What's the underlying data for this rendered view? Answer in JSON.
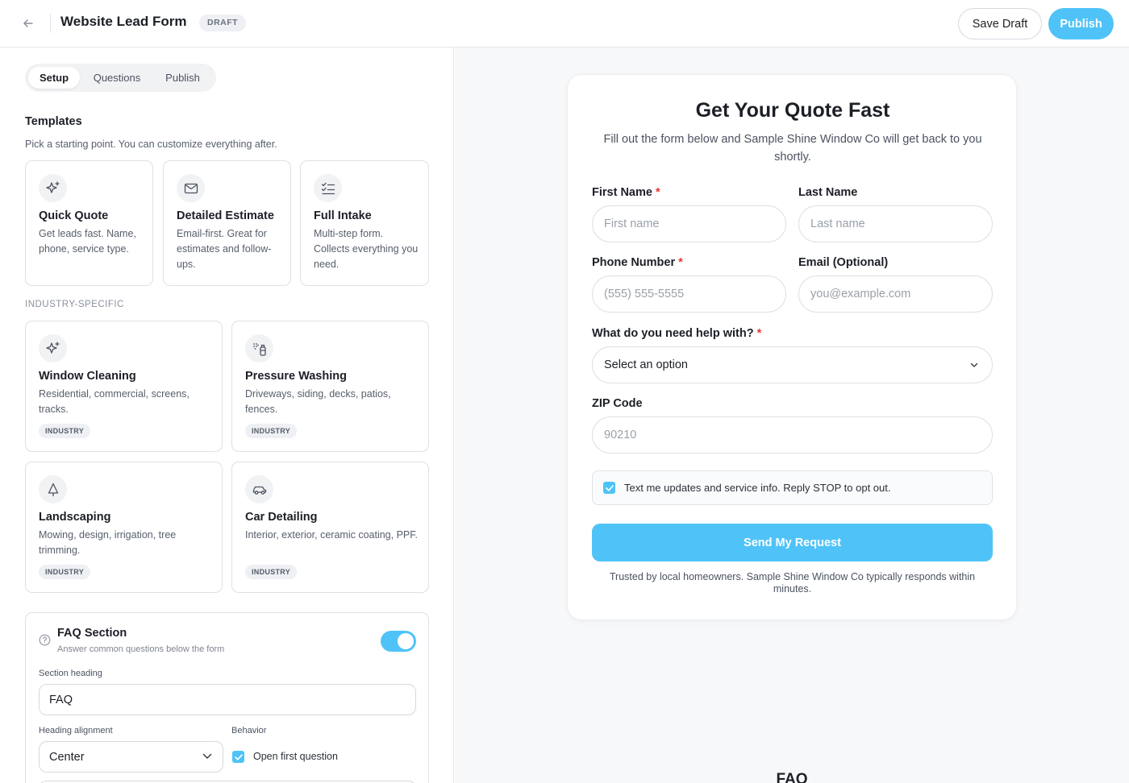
{
  "header": {
    "title": "Website Lead Form",
    "status": "DRAFT",
    "save_label": "Save Draft",
    "publish_label": "Publish"
  },
  "tabs": [
    {
      "label": "Setup",
      "active": true
    },
    {
      "label": "Questions",
      "active": false
    },
    {
      "label": "Publish",
      "active": false
    }
  ],
  "templates": {
    "title": "Templates",
    "subtitle": "Pick a starting point. You can customize everything after.",
    "general": [
      {
        "icon": "sparkles-icon",
        "title": "Quick Quote",
        "desc": "Get leads fast. Name, phone, service type."
      },
      {
        "icon": "mail-icon",
        "title": "Detailed Estimate",
        "desc": "Email-first. Great for estimates and follow-ups."
      },
      {
        "icon": "checklist-icon",
        "title": "Full Intake",
        "desc": "Multi-step form. Collects everything you need."
      }
    ],
    "industry_label": "INDUSTRY-SPECIFIC",
    "industry": [
      {
        "icon": "sparkles-icon",
        "title": "Window Cleaning",
        "desc": "Residential, commercial, screens, tracks.",
        "tag": "INDUSTRY"
      },
      {
        "icon": "spray-bottle-icon",
        "title": "Pressure Washing",
        "desc": "Driveways, siding, decks, patios, fences.",
        "tag": "INDUSTRY"
      },
      {
        "icon": "tree-icon",
        "title": "Landscaping",
        "desc": "Mowing, design, irrigation, tree trimming.",
        "tag": "INDUSTRY"
      },
      {
        "icon": "car-icon",
        "title": "Car Detailing",
        "desc": "Interior, exterior, ceramic coating, PPF.",
        "tag": "INDUSTRY"
      }
    ]
  },
  "faq": {
    "title": "FAQ Section",
    "subtitle": "Answer common questions below the form",
    "enabled": true,
    "heading_label": "Section heading",
    "heading_value": "FAQ",
    "alignment_label": "Heading alignment",
    "alignment_value": "Center",
    "behavior_label": "Behavior",
    "open_first_label": "Open first question",
    "open_first_checked": true
  },
  "preview": {
    "title": "Get Your Quote Fast",
    "subtitle": "Fill out the form below and Sample Shine Window Co will get back to you shortly.",
    "first_name_label": "First Name",
    "first_name_placeholder": "First name",
    "last_name_label": "Last Name",
    "last_name_placeholder": "Last name",
    "phone_label": "Phone Number",
    "phone_placeholder": "(555) 555-5555",
    "email_label": "Email (Optional)",
    "email_placeholder": "you@example.com",
    "help_label": "What do you need help with?",
    "help_value": "Select an option",
    "zip_label": "ZIP Code",
    "zip_placeholder": "90210",
    "required_mark": "*",
    "consent_text": "Text me updates and service info. Reply STOP to opt out.",
    "consent_checked": true,
    "submit_label": "Send My Request",
    "trust_text": "Trusted by local homeowners. Sample Shine Window Co typically responds within minutes.",
    "faq_heading": "FAQ"
  },
  "colors": {
    "accent": "#4fc3f7",
    "required": "#e53935"
  }
}
